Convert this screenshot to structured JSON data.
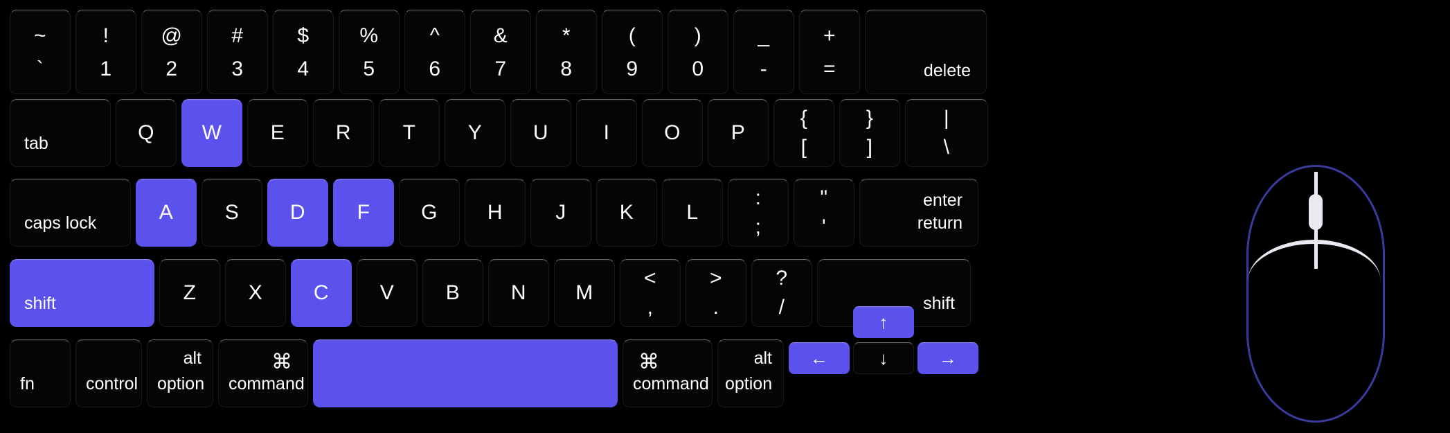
{
  "theme": {
    "background": "#000000",
    "key_fill": "#050505",
    "key_border": "#191919",
    "key_text": "#ffffff",
    "highlight": "#5b51ec",
    "mouse_outline": "#3b3b9e",
    "mouse_accent": "#e9e9f2"
  },
  "keyboard": {
    "rows": [
      {
        "name": "number-row",
        "keys": [
          {
            "id": "backquote",
            "top": "~",
            "bottom": "`",
            "active": false
          },
          {
            "id": "digit1",
            "top": "!",
            "bottom": "1",
            "active": false
          },
          {
            "id": "digit2",
            "top": "@",
            "bottom": "2",
            "active": false
          },
          {
            "id": "digit3",
            "top": "#",
            "bottom": "3",
            "active": false
          },
          {
            "id": "digit4",
            "top": "$",
            "bottom": "4",
            "active": false
          },
          {
            "id": "digit5",
            "top": "%",
            "bottom": "5",
            "active": false
          },
          {
            "id": "digit6",
            "top": "^",
            "bottom": "6",
            "active": false
          },
          {
            "id": "digit7",
            "top": "&",
            "bottom": "7",
            "active": false
          },
          {
            "id": "digit8",
            "top": "*",
            "bottom": "8",
            "active": false
          },
          {
            "id": "digit9",
            "top": "(",
            "bottom": "9",
            "active": false
          },
          {
            "id": "digit0",
            "top": ")",
            "bottom": "0",
            "active": false
          },
          {
            "id": "minus",
            "top": "_",
            "bottom": "-",
            "active": false
          },
          {
            "id": "equal",
            "top": "+",
            "bottom": "=",
            "active": false
          },
          {
            "id": "delete",
            "word": "delete",
            "active": false
          }
        ]
      },
      {
        "name": "qwerty-row",
        "keys": [
          {
            "id": "tab",
            "word": "tab",
            "active": false
          },
          {
            "id": "keyq",
            "label": "Q",
            "active": false
          },
          {
            "id": "keyw",
            "label": "W",
            "active": true
          },
          {
            "id": "keye",
            "label": "E",
            "active": false
          },
          {
            "id": "keyr",
            "label": "R",
            "active": false
          },
          {
            "id": "keyt",
            "label": "T",
            "active": false
          },
          {
            "id": "keyy",
            "label": "Y",
            "active": false
          },
          {
            "id": "keyu",
            "label": "U",
            "active": false
          },
          {
            "id": "keyi",
            "label": "I",
            "active": false
          },
          {
            "id": "keyo",
            "label": "O",
            "active": false
          },
          {
            "id": "keyp",
            "label": "P",
            "active": false
          },
          {
            "id": "bracketleft",
            "top": "{",
            "bottom": "[",
            "active": false
          },
          {
            "id": "bracketright",
            "top": "}",
            "bottom": "]",
            "active": false
          },
          {
            "id": "backslash",
            "top": "|",
            "bottom": "\\",
            "active": false
          }
        ]
      },
      {
        "name": "home-row",
        "keys": [
          {
            "id": "capslock",
            "word": "caps lock",
            "active": false
          },
          {
            "id": "keya",
            "label": "A",
            "active": true
          },
          {
            "id": "keys",
            "label": "S",
            "active": false
          },
          {
            "id": "keyd",
            "label": "D",
            "active": true
          },
          {
            "id": "keyf",
            "label": "F",
            "active": true
          },
          {
            "id": "keyg",
            "label": "G",
            "active": false
          },
          {
            "id": "keyh",
            "label": "H",
            "active": false
          },
          {
            "id": "keyj",
            "label": "J",
            "active": false
          },
          {
            "id": "keyk",
            "label": "K",
            "active": false
          },
          {
            "id": "keyl",
            "label": "L",
            "active": false
          },
          {
            "id": "semicolon",
            "top": ":",
            "bottom": ";",
            "active": false
          },
          {
            "id": "quote",
            "top": "\"",
            "bottom": "'",
            "active": false
          },
          {
            "id": "return",
            "word": "return",
            "word2": "enter",
            "active": false
          }
        ]
      },
      {
        "name": "shift-row",
        "keys": [
          {
            "id": "shiftleft",
            "word": "shift",
            "active": true
          },
          {
            "id": "keyz",
            "label": "Z",
            "active": false
          },
          {
            "id": "keyx",
            "label": "X",
            "active": false
          },
          {
            "id": "keyc",
            "label": "C",
            "active": true
          },
          {
            "id": "keyv",
            "label": "V",
            "active": false
          },
          {
            "id": "keyb",
            "label": "B",
            "active": false
          },
          {
            "id": "keyn",
            "label": "N",
            "active": false
          },
          {
            "id": "keym",
            "label": "M",
            "active": false
          },
          {
            "id": "comma",
            "top": "<",
            "bottom": ",",
            "active": false
          },
          {
            "id": "period",
            "top": ">",
            "bottom": ".",
            "active": false
          },
          {
            "id": "slash",
            "top": "?",
            "bottom": "/",
            "active": false
          },
          {
            "id": "shiftright",
            "word": "shift",
            "active": false
          }
        ]
      },
      {
        "name": "modifier-row",
        "keys": [
          {
            "id": "fn",
            "word": "fn",
            "active": false
          },
          {
            "id": "controlleft",
            "word": "control",
            "active": false
          },
          {
            "id": "optionleft",
            "word": "option",
            "word2": "alt",
            "active": false
          },
          {
            "id": "commandleft",
            "word": "command",
            "word2": "⌘",
            "active": false
          },
          {
            "id": "space",
            "word": "",
            "active": true
          },
          {
            "id": "commandright",
            "word": "command",
            "word2": "⌘",
            "active": false
          },
          {
            "id": "optionright",
            "word": "option",
            "word2": "alt",
            "active": false
          },
          {
            "id": "arrowleft",
            "label": "←",
            "active": true
          },
          {
            "id": "arrowup",
            "label": "↑",
            "active": true
          },
          {
            "id": "arrowdown",
            "label": "↓",
            "active": false
          },
          {
            "id": "arrowright",
            "label": "→",
            "active": true
          }
        ]
      }
    ]
  },
  "mouse": {
    "name": "mouse-diagram",
    "buttons": [
      "left-button",
      "right-button"
    ],
    "wheel": "scroll-wheel"
  }
}
